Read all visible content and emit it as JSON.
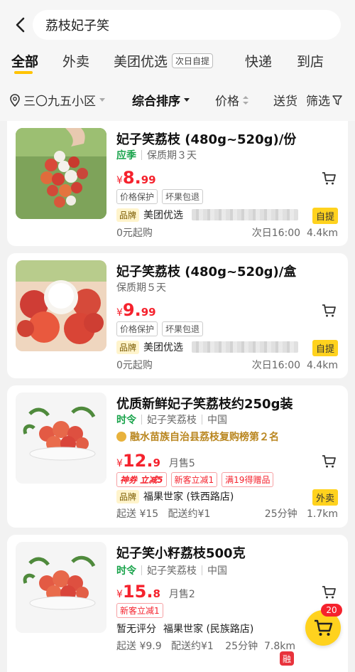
{
  "search": {
    "value": "荔枝妃子笑"
  },
  "tabs": [
    {
      "label": "全部"
    },
    {
      "label": "外卖"
    },
    {
      "label": "美团优选",
      "badge": "次日自提"
    },
    {
      "label": "快递"
    },
    {
      "label": "到店"
    }
  ],
  "filters": {
    "location": "三〇九五小区",
    "sort": "综合排序",
    "price": "价格",
    "delivery": "送货",
    "filter": "筛选"
  },
  "products": [
    {
      "title": "妃子笑荔枝 (480g~520g)/份",
      "season": "应季",
      "shelf": "保质期３天",
      "price_currency": "¥",
      "price_int": "8.",
      "price_dec": "99",
      "tags": [
        "价格保护",
        "坏果包退"
      ],
      "brand_label": "品牌",
      "brand": "美团优选",
      "badge": "自提",
      "min_order": "0元起购",
      "time": "次日16:00",
      "distance": "4.4km"
    },
    {
      "title": "妃子笑荔枝 (480g~520g)/盒",
      "shelf": "保质期５天",
      "price_currency": "¥",
      "price_int": "9.",
      "price_dec": "99",
      "tags": [
        "价格保护",
        "坏果包退"
      ],
      "brand_label": "品牌",
      "brand": "美团优选",
      "badge": "自提",
      "min_order": "0元起购",
      "time": "次日16:00",
      "distance": "4.4km"
    },
    {
      "title": "优质新鲜妃子笑荔枝约250g装",
      "season": "时令",
      "variety": "妃子笑荔枝",
      "origin": "中国",
      "rank": "融水苗族自治县荔枝复购榜第２名",
      "price_currency": "¥",
      "price_int": "12.",
      "price_dec": "9",
      "sold": "月售5",
      "tags": [
        "神券 立减5",
        "新客立减1",
        "满19得赠品"
      ],
      "brand_label": "品牌",
      "brand": "福果世家 (铁西路店)",
      "badge": "外卖",
      "min_order": "起送 ¥15",
      "fee": "配送约¥1",
      "time": "25分钟",
      "distance": "1.7km"
    },
    {
      "title": "妃子笑小籽荔枝500克",
      "season": "时令",
      "variety": "妃子笑荔枝",
      "origin": "中国",
      "price_currency": "¥",
      "price_int": "15.",
      "price_dec": "8",
      "sold": "月售2",
      "tags": [
        "新客立减1"
      ],
      "rating": "暂无评分",
      "brand": "福果世家 (民族路店)",
      "min_order": "起送 ¥9.9",
      "fee": "配送约¥1",
      "time": "25分钟",
      "distance": "7.8km"
    }
  ],
  "cart_count": "20",
  "watermark": "融水时门户",
  "colors": {
    "accent": "#ffc300",
    "price": "#f5222d",
    "green": "#18a34a"
  }
}
